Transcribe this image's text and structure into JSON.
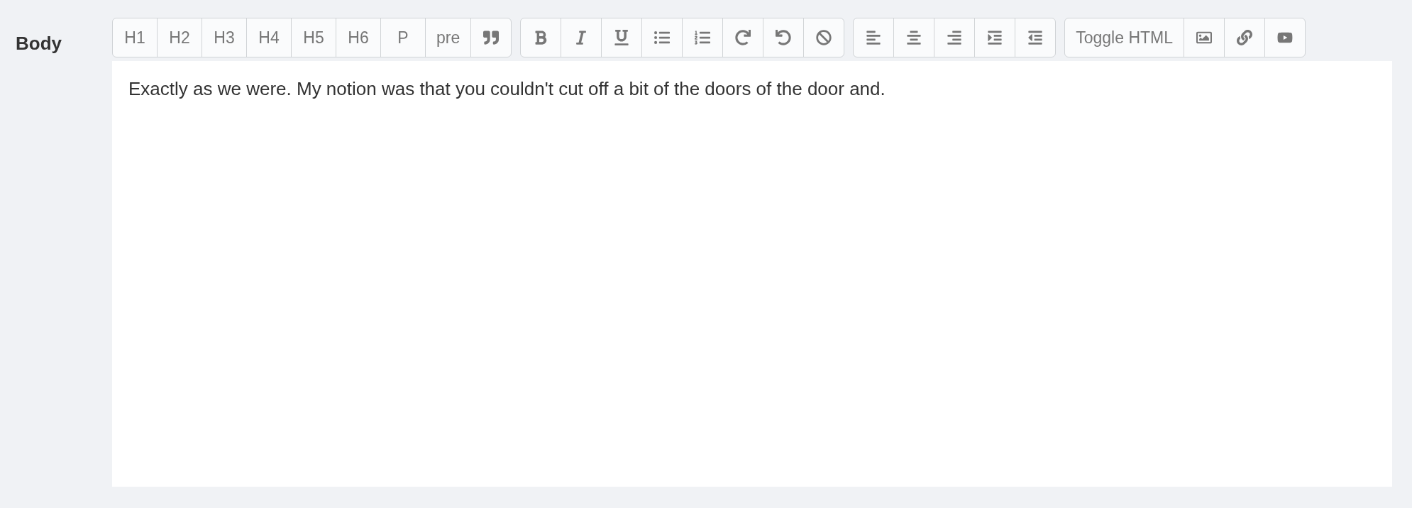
{
  "field": {
    "label": "Body"
  },
  "toolbar": [
    {
      "buttons": [
        {
          "kind": "text",
          "label": "H1"
        },
        {
          "kind": "text",
          "label": "H2"
        },
        {
          "kind": "text",
          "label": "H3"
        },
        {
          "kind": "text",
          "label": "H4"
        },
        {
          "kind": "text",
          "label": "H5"
        },
        {
          "kind": "text",
          "label": "H6"
        },
        {
          "kind": "text",
          "label": "P"
        },
        {
          "kind": "text",
          "label": "pre"
        },
        {
          "kind": "icon"
        }
      ]
    },
    {
      "buttons": [
        {
          "kind": "icon"
        },
        {
          "kind": "icon"
        },
        {
          "kind": "icon"
        },
        {
          "kind": "icon"
        },
        {
          "kind": "icon"
        },
        {
          "kind": "icon"
        },
        {
          "kind": "icon"
        },
        {
          "kind": "icon"
        }
      ]
    },
    {
      "buttons": [
        {
          "kind": "icon"
        },
        {
          "kind": "icon"
        },
        {
          "kind": "icon"
        },
        {
          "kind": "icon"
        },
        {
          "kind": "icon"
        }
      ]
    },
    {
      "buttons": [
        {
          "kind": "text",
          "label": "Toggle HTML"
        },
        {
          "kind": "icon"
        },
        {
          "kind": "icon"
        },
        {
          "kind": "icon"
        }
      ]
    }
  ],
  "editor": {
    "value": "Exactly as we were. My notion was that you couldn't cut off a bit of the doors of the door and."
  }
}
